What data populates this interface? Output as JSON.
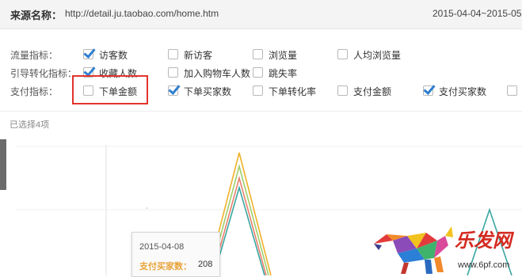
{
  "source": {
    "label": "来源名称：",
    "url": "http://detail.ju.taobao.com/home.htm"
  },
  "date_range": "2015-04-04~2015-05",
  "rows": [
    {
      "label": "流量指标：",
      "items": [
        {
          "label": "访客数",
          "checked": true
        },
        {
          "label": "新访客",
          "checked": false
        },
        {
          "label": "浏览量",
          "checked": false
        },
        {
          "label": "人均浏览量",
          "checked": false
        }
      ]
    },
    {
      "label": "引导转化指标：",
      "items": [
        {
          "label": "收藏人数",
          "checked": true
        },
        {
          "label": "加入购物车人数",
          "checked": false
        },
        {
          "label": "跳失率",
          "checked": false
        }
      ]
    },
    {
      "label": "支付指标：",
      "items": [
        {
          "label": "下单金额",
          "checked": false
        },
        {
          "label": "下单买家数",
          "checked": true
        },
        {
          "label": "下单转化率",
          "checked": false
        },
        {
          "label": "支付金额",
          "checked": false
        },
        {
          "label": "支付买家数",
          "checked": true
        },
        {
          "label": "",
          "checked": false
        }
      ]
    }
  ],
  "selected_count": "已选择4项",
  "tooltip": {
    "date": "2015-04-08",
    "metric": "支付买家数：",
    "value": "208"
  },
  "watermark": {
    "brand": "乐发网",
    "url": "www.6pf.com"
  },
  "colors": {
    "checkmark": "#2f7fd0",
    "highlight": "#e2342b",
    "series": [
      "#f0b128",
      "#3aa6a0",
      "#e9806e",
      "#9fcf6a",
      "#8bb8e0"
    ]
  }
}
